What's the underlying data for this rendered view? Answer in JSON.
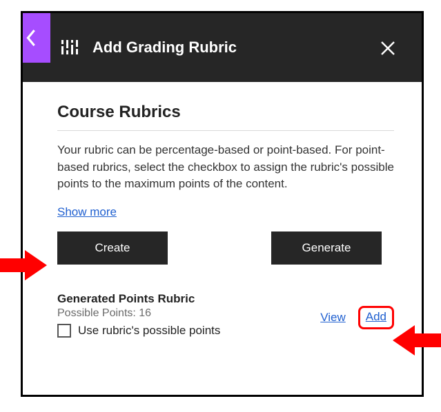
{
  "header": {
    "title": "Add Grading Rubric"
  },
  "section": {
    "title": "Course Rubrics",
    "description": "Your rubric can be percentage-based or point-based. For point-based rubrics, select the checkbox to assign the rubric's possible points to the maximum points of the content.",
    "show_more": "Show more"
  },
  "buttons": {
    "create": "Create",
    "generate": "Generate"
  },
  "rubric_item": {
    "name": "Generated Points Rubric",
    "possible_points_label": "Possible Points: 16",
    "view": "View",
    "add": "Add",
    "checkbox_label": "Use rubric's possible points"
  }
}
